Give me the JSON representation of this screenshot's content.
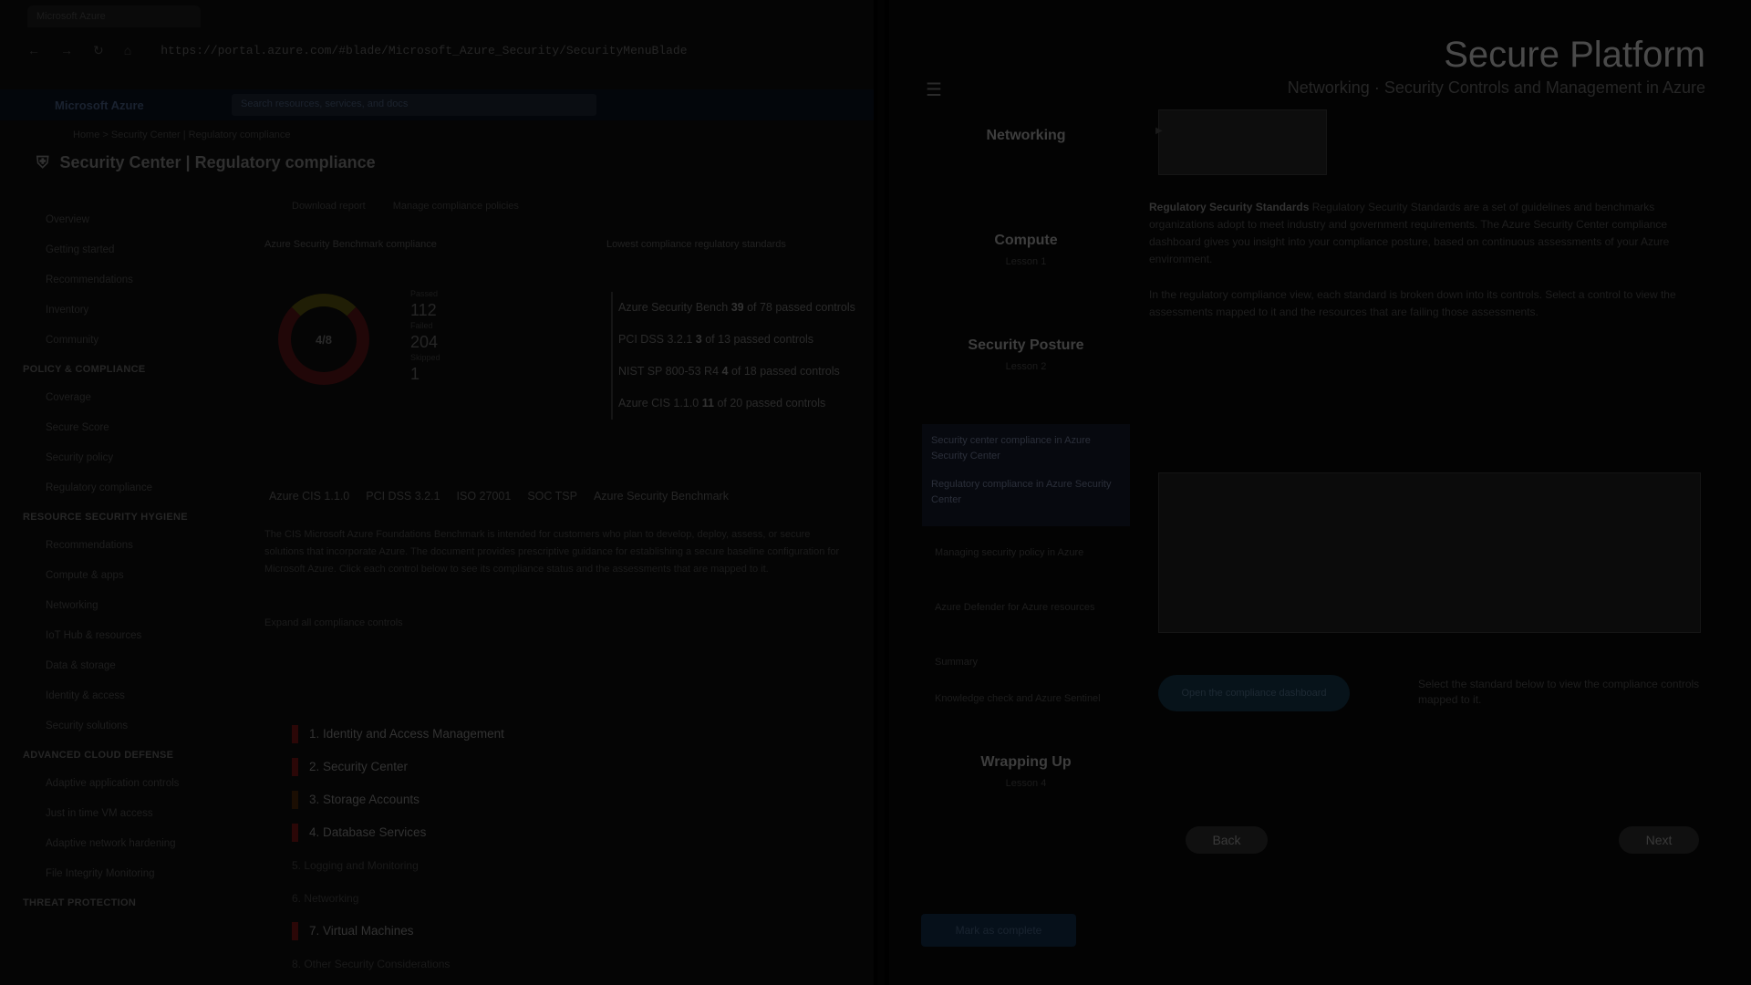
{
  "browser": {
    "tab_label": "Microsoft Azure",
    "url": "https://portal.azure.com/#blade/Microsoft_Azure_Security/SecurityMenuBlade",
    "nav_icons": [
      "back-icon",
      "forward-icon",
      "refresh-icon",
      "home-icon"
    ]
  },
  "azure": {
    "brand": "Microsoft Azure",
    "search_placeholder": "Search resources, services, and docs",
    "breadcrumb": "Home > Security Center | Regulatory compliance",
    "blade_title": "Security Center | Regulatory compliance"
  },
  "left_nav": {
    "top_items": [
      "Overview",
      "Getting started",
      "Recommendations",
      "Inventory",
      "Community",
      "Regulatory compliance"
    ],
    "policy_head": "POLICY & COMPLIANCE",
    "policy_items": [
      "Coverage",
      "Secure Score",
      "Security policy",
      "Regulatory compliance"
    ],
    "threat_head": "RESOURCE SECURITY HYGIENE",
    "threat_items": [
      "Recommendations",
      "Compute & apps",
      "Networking",
      "IoT Hub & resources",
      "Data & storage",
      "Identity & access",
      "Security solutions"
    ],
    "advanced_head": "ADVANCED CLOUD DEFENSE",
    "advanced_items": [
      "Adaptive application controls",
      "Just in time VM access",
      "Adaptive network hardening",
      "File Integrity Monitoring"
    ],
    "more_head": "THREAT PROTECTION"
  },
  "content": {
    "tabs": [
      "Download report",
      "Manage compliance policies"
    ],
    "left_card_title": "Azure Security Benchmark compliance",
    "right_card_title": "Lowest compliance regulatory standards",
    "donut_label": "4/8",
    "stats": [
      {
        "label": "Passed",
        "value": "112"
      },
      {
        "label": "Failed",
        "value": "204"
      },
      {
        "label": "Skipped",
        "value": "1"
      }
    ],
    "standards": [
      {
        "name": "Azure Security Bench",
        "count": "39",
        "suffix": "of 78 passed controls"
      },
      {
        "name": "PCI DSS 3.2.1",
        "count": "3",
        "suffix": "of 13 passed controls"
      },
      {
        "name": "NIST SP 800-53 R4",
        "count": "4",
        "suffix": "of 18 passed controls"
      },
      {
        "name": "Azure CIS 1.1.0",
        "count": "11",
        "suffix": "of 20 passed controls"
      }
    ],
    "control_tabs": [
      "Azure CIS 1.1.0",
      "PCI DSS 3.2.1",
      "ISO 27001",
      "SOC TSP",
      "Azure Security Benchmark"
    ],
    "paragraph": "The CIS Microsoft Azure Foundations Benchmark is intended for customers who plan to develop, deploy, assess, or secure solutions that incorporate Azure. The document provides prescriptive guidance for establishing a secure baseline configuration for Microsoft Azure. Click each control below to see its compliance status and the assessments that are mapped to it.",
    "expand_label": "Expand all compliance controls",
    "controls": [
      {
        "label": "1. Identity and Access Management",
        "state": "fail"
      },
      {
        "label": "2. Security Center",
        "state": "fail"
      },
      {
        "label": "3. Storage Accounts",
        "state": "warn"
      },
      {
        "label": "4. Database Services",
        "state": "fail"
      },
      {
        "label": "5. Logging and Monitoring",
        "state": "none"
      },
      {
        "label": "6. Networking",
        "state": "none"
      },
      {
        "label": "7. Virtual Machines",
        "state": "fail"
      },
      {
        "label": "8. Other Security Considerations",
        "state": "none"
      }
    ]
  },
  "course": {
    "title": "Secure Platform",
    "subtitle": "Networking · Security Controls and Management in Azure",
    "modules": [
      {
        "title": "Networking",
        "sub": ""
      },
      {
        "title": "Compute",
        "sub": "Lesson 1"
      },
      {
        "title": "Security Posture",
        "sub": "Lesson 2"
      }
    ],
    "active_lessons": [
      "Security center compliance in Azure Security Center",
      "Regulatory compliance in Azure Security Center"
    ],
    "lessons": [
      "Managing security policy in Azure",
      "Azure Defender for Azure resources",
      "Summary",
      "Knowledge check and Azure Sentinel"
    ],
    "wrap_module": {
      "title": "Wrapping Up",
      "sub": "Lesson 4"
    },
    "lesson_heading": "Regulatory Security Standards",
    "lesson_para1": "Regulatory Security Standards are a set of guidelines and benchmarks organizations adopt to meet industry and government requirements. The Azure Security Center compliance dashboard gives you insight into your compliance posture, based on continuous assessments of your Azure environment.",
    "lesson_para2": "In the regulatory compliance view, each standard is broken down into its controls. Select a control to view the assessments mapped to it and the resources that are failing those assessments.",
    "pill_label": "Open the compliance dashboard",
    "side_note": "Select the standard below to view the compliance controls mapped to it.",
    "back_label": "Back",
    "next_label": "Next",
    "footer_button": "Mark as complete"
  }
}
